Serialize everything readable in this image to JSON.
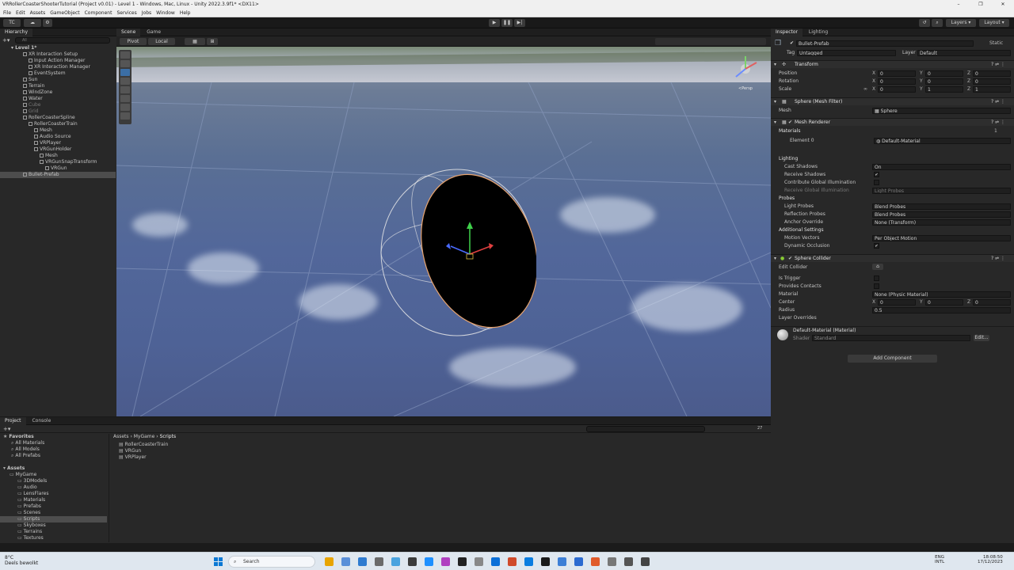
{
  "window": {
    "title": "VRRollerCoasterShooterTutorial (Project v0.01) - Level 1 - Windows, Mac, Linux - Unity 2022.3.9f1* <DX11>",
    "min": "–",
    "max": "❐",
    "close": "✕"
  },
  "menu": [
    "File",
    "Edit",
    "Assets",
    "GameObject",
    "Component",
    "Services",
    "Jobs",
    "Window",
    "Help"
  ],
  "toolbar": {
    "account": "TC",
    "layers": "Layers",
    "layout": "Layout"
  },
  "hierarchy": {
    "tab": "Hierarchy",
    "search_placeholder": "All",
    "scene": "Level 1*",
    "items": [
      {
        "label": "XR Interaction Setup",
        "d": 1
      },
      {
        "label": "Input Action Manager",
        "d": 2
      },
      {
        "label": "XR Interaction Manager",
        "d": 2
      },
      {
        "label": "EventSystem",
        "d": 2
      },
      {
        "label": "Sun",
        "d": 1
      },
      {
        "label": "Terrain",
        "d": 1
      },
      {
        "label": "WindZone",
        "d": 1
      },
      {
        "label": "Water",
        "d": 1
      },
      {
        "label": "Cube",
        "d": 1,
        "dim": true
      },
      {
        "label": "Grid",
        "d": 1,
        "dim": true
      },
      {
        "label": "RollerCoasterSpline",
        "d": 1
      },
      {
        "label": "RollerCoasterTrain",
        "d": 2
      },
      {
        "label": "Mesh",
        "d": 3
      },
      {
        "label": "Audio Source",
        "d": 3
      },
      {
        "label": "VRPlayer",
        "d": 3
      },
      {
        "label": "VRGunHolder",
        "d": 3
      },
      {
        "label": "Mesh",
        "d": 4
      },
      {
        "label": "VRGunSnapTransform",
        "d": 4
      },
      {
        "label": "VRGun",
        "d": 5
      },
      {
        "label": "Bullet-Prefab",
        "d": 1,
        "sel": true
      }
    ]
  },
  "scene_view": {
    "tabs": [
      "Scene",
      "Game"
    ],
    "pivot": "Pivot",
    "local": "Local",
    "gizmo_label": "<Persp"
  },
  "inspector": {
    "tabs": [
      "Inspector",
      "Lighting"
    ],
    "object_name": "Bullet-Prefab",
    "static_label": "Static",
    "tag_label": "Tag",
    "tag": "Untagged",
    "layer_label": "Layer",
    "layer": "Default",
    "transform": {
      "title": "Transform",
      "position": "Position",
      "rotation": "Rotation",
      "scale": "Scale",
      "pos": [
        "0",
        "0",
        "0"
      ],
      "rot": [
        "0",
        "0",
        "0"
      ],
      "scl": [
        "0",
        "1",
        "1"
      ]
    },
    "mesh_filter": {
      "title": "Sphere (Mesh Filter)",
      "mesh_label": "Mesh",
      "mesh": "Sphere"
    },
    "mesh_renderer": {
      "title": "Mesh Renderer",
      "materials": "Materials",
      "materials_count": "1",
      "element0": "Element 0",
      "element0_value": "Default-Material",
      "lighting": "Lighting",
      "cast_shadows": "Cast Shadows",
      "cast_shadows_v": "On",
      "receive_shadows": "Receive Shadows",
      "contribute_gi": "Contribute Global Illumination",
      "receive_gi": "Receive Global Illumination",
      "receive_gi_v": "Light Probes",
      "probes": "Probes",
      "light_probes": "Light Probes",
      "light_probes_v": "Blend Probes",
      "reflection_probes": "Reflection Probes",
      "reflection_probes_v": "Blend Probes",
      "anchor_override": "Anchor Override",
      "anchor_override_v": "None (Transform)",
      "additional": "Additional Settings",
      "motion_vectors": "Motion Vectors",
      "motion_vectors_v": "Per Object Motion",
      "dynamic_occlusion": "Dynamic Occlusion"
    },
    "sphere_collider": {
      "title": "Sphere Collider",
      "edit_collider": "Edit Collider",
      "is_trigger": "Is Trigger",
      "provides_contacts": "Provides Contacts",
      "material": "Material",
      "material_v": "None (Physic Material)",
      "center": "Center",
      "center_v": [
        "0",
        "0",
        "0"
      ],
      "radius": "Radius",
      "radius_v": "0.5",
      "layer_overrides": "Layer Overrides"
    },
    "material": {
      "name": "Default-Material (Material)",
      "shader_label": "Shader",
      "shader": "Standard",
      "edit": "Edit..."
    },
    "add_component": "Add Component"
  },
  "project": {
    "tabs": [
      "Project",
      "Console"
    ],
    "favorites": "Favorites",
    "fav_items": [
      "All Materials",
      "All Models",
      "All Prefabs"
    ],
    "assets": "Assets",
    "mygame": "MyGame",
    "folders": [
      "3DModels",
      "Audio",
      "LensFlares",
      "Materials",
      "Prefabs",
      "Scenes",
      "Scripts",
      "Skyboxes",
      "Terrains",
      "Textures"
    ],
    "breadcrumb": [
      "Assets",
      "MyGame",
      "Scripts"
    ],
    "files": [
      "RollerCoasterTrain",
      "VRGun",
      "VRPlayer"
    ],
    "count": "27"
  },
  "taskbar": {
    "weather_temp": "8°C",
    "weather_text": "Deels bewolkt",
    "search": "Search",
    "lang1": "ENG",
    "lang2": "INTL",
    "time": "18:08:50",
    "date": "17/12/2023"
  },
  "colors": {
    "selection": "#4d4d4d",
    "accent": "#3b6ea5"
  }
}
